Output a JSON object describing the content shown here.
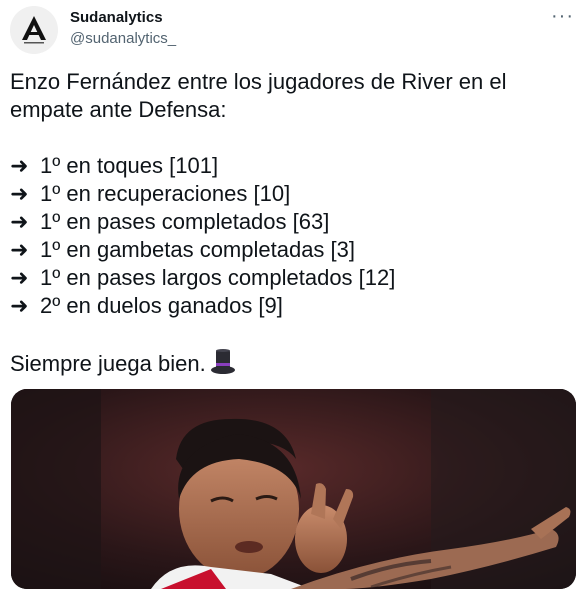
{
  "author": {
    "name": "Sudanalytics",
    "handle": "@sudanalytics_",
    "avatar_icon": "sudanalytics-logo-icon"
  },
  "more_icon": "more-options-icon",
  "tweet": {
    "intro_line1": "Enzo Fernández entre los jugadores de River en el",
    "intro_line2": "empate ante Defensa:",
    "arrow_glyph": "➜",
    "stats": [
      "1º en toques [101]",
      "1º en recuperaciones [10]",
      "1º en pases completados [63]",
      "1º en gambetas completadas [3]",
      "1º en pases largos completados [12]",
      "2º en duelos ganados [9]"
    ],
    "closing": "Siempre juega bien.",
    "closing_emoji": "top-hat-icon"
  },
  "media": {
    "description_icon": "photo-player-celebrating",
    "colors": {
      "background": "#1a1214",
      "accent": "#c8102e"
    }
  }
}
